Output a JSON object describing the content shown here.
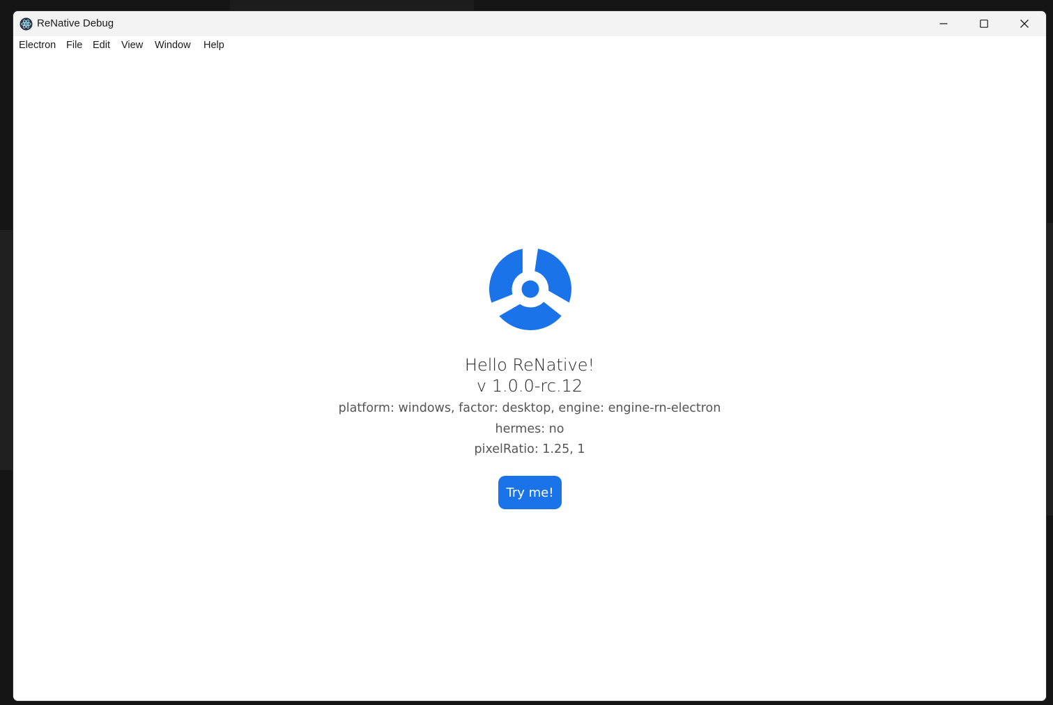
{
  "window": {
    "title": "ReNative Debug"
  },
  "menu": {
    "items": [
      {
        "label": "Electron"
      },
      {
        "label": "File"
      },
      {
        "label": "Edit"
      },
      {
        "label": "View"
      },
      {
        "label": "Window"
      },
      {
        "label": "Help"
      }
    ]
  },
  "main": {
    "greeting": "Hello ReNative!",
    "version": "v 1.0.0-rc.12",
    "platform_info": "platform: windows, factor: desktop, engine: engine-rn-electron",
    "hermes_info": "hermes: no",
    "pixel_ratio_info": "pixelRatio: 1.25, 1",
    "try_button_label": "Try me!"
  },
  "icons": {
    "app": "electron-atom-icon",
    "logo": "renative-logo-icon",
    "minimize": "minimize-icon",
    "maximize": "maximize-icon",
    "close": "close-icon"
  },
  "colors": {
    "accent": "#1a73e8",
    "titlebar": "#f3f3f3",
    "background": "#ffffff"
  }
}
